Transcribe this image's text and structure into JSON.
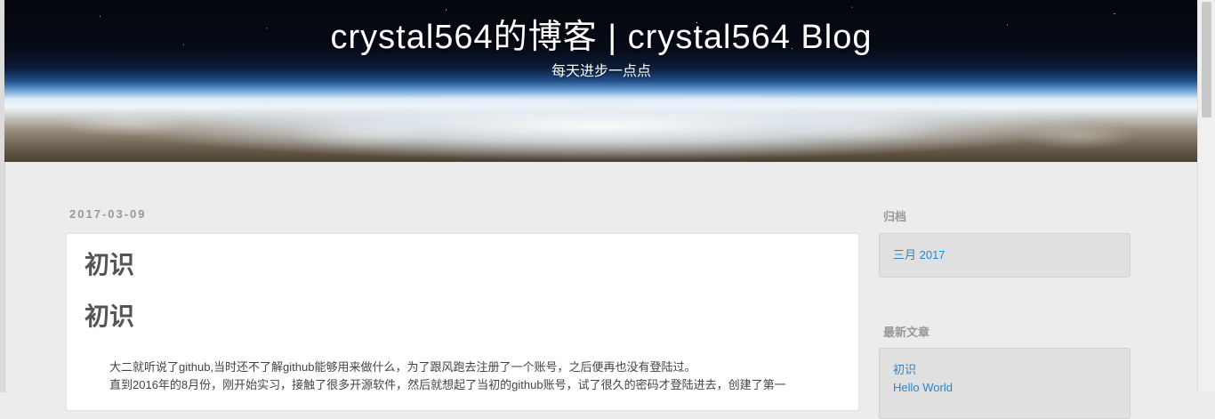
{
  "header": {
    "title": "crystal564的博客 | crystal564 Blog",
    "subtitle": "每天进步一点点"
  },
  "post": {
    "date": "2017-03-09",
    "title": "初识",
    "heading": "初识",
    "paragraphs": [
      "大二就听说了github,当时还不了解github能够用来做什么，为了跟风跑去注册了一个账号，之后便再也没有登陆过。",
      "直到2016年的8月份，刚开始实习，接触了很多开源软件，然后就想起了当初的github账号，试了很久的密码才登陆进去，创建了第一"
    ]
  },
  "sidebar": {
    "archive": {
      "title": "归档",
      "items": [
        "三月 2017"
      ]
    },
    "recent": {
      "title": "最新文章",
      "items": [
        "初识",
        "Hello World"
      ]
    }
  }
}
